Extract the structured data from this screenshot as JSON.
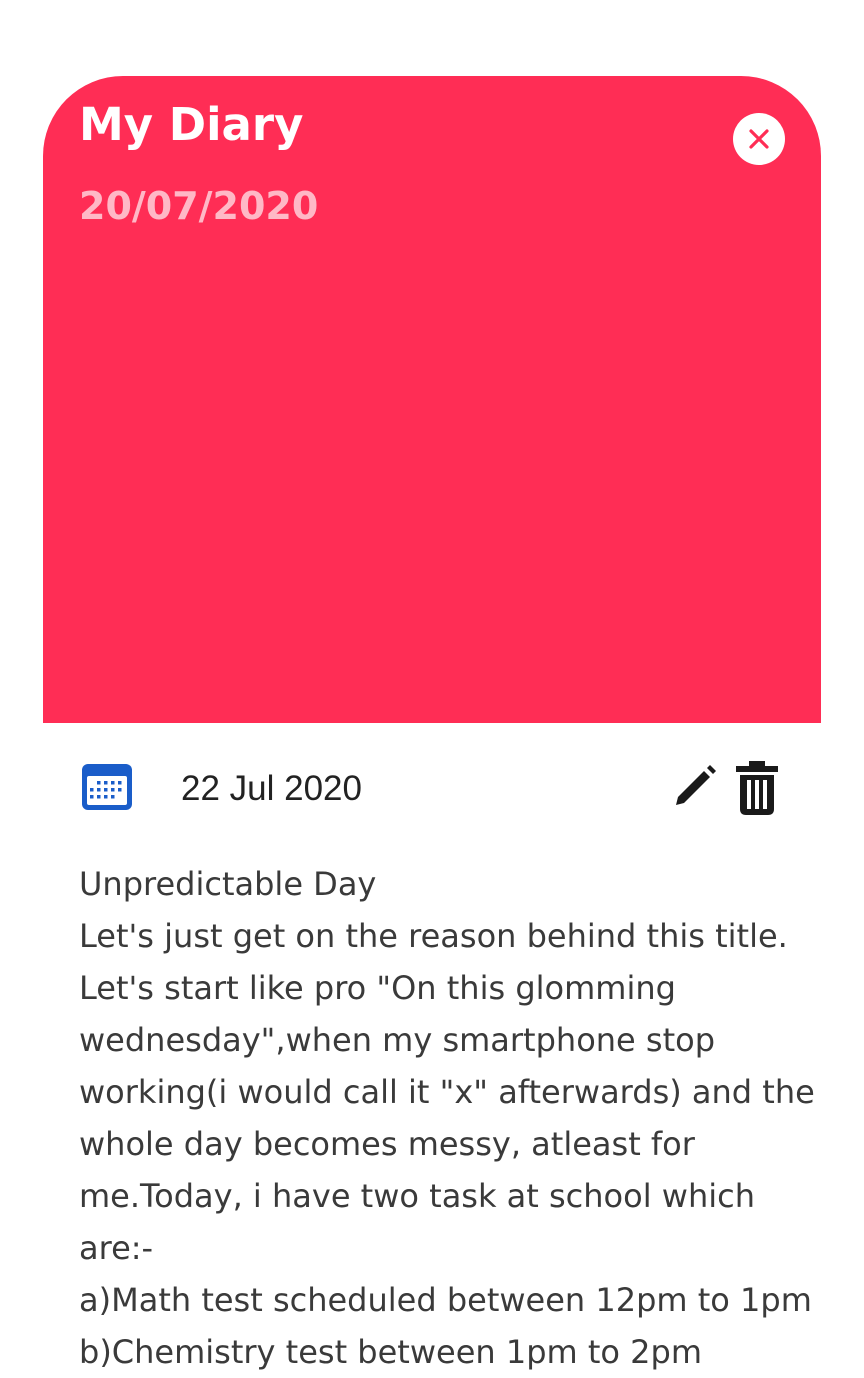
{
  "card": {
    "title": "My Diary",
    "date": "20/07/2020",
    "background_color": "#ff2d55",
    "close_icon": "close-icon"
  },
  "entry": {
    "date": "22 Jul 2020",
    "calendar_icon": "calendar-icon",
    "edit_icon": "pencil-icon",
    "delete_icon": "trash-icon",
    "lines": [
      "Unpredictable Day",
      "Let's just get on the reason behind this title.",
      "Let's start like pro \"On this glomming",
      "wednesday\",when my smartphone stop",
      "working(i would call it \"x\" afterwards) and the",
      "whole day becomes messy, atleast for",
      "me.Today, i have two task at school which",
      "are:-",
      "a)Math test scheduled between 12pm to 1pm",
      "b)Chemistry test between 1pm to 2pm"
    ]
  }
}
